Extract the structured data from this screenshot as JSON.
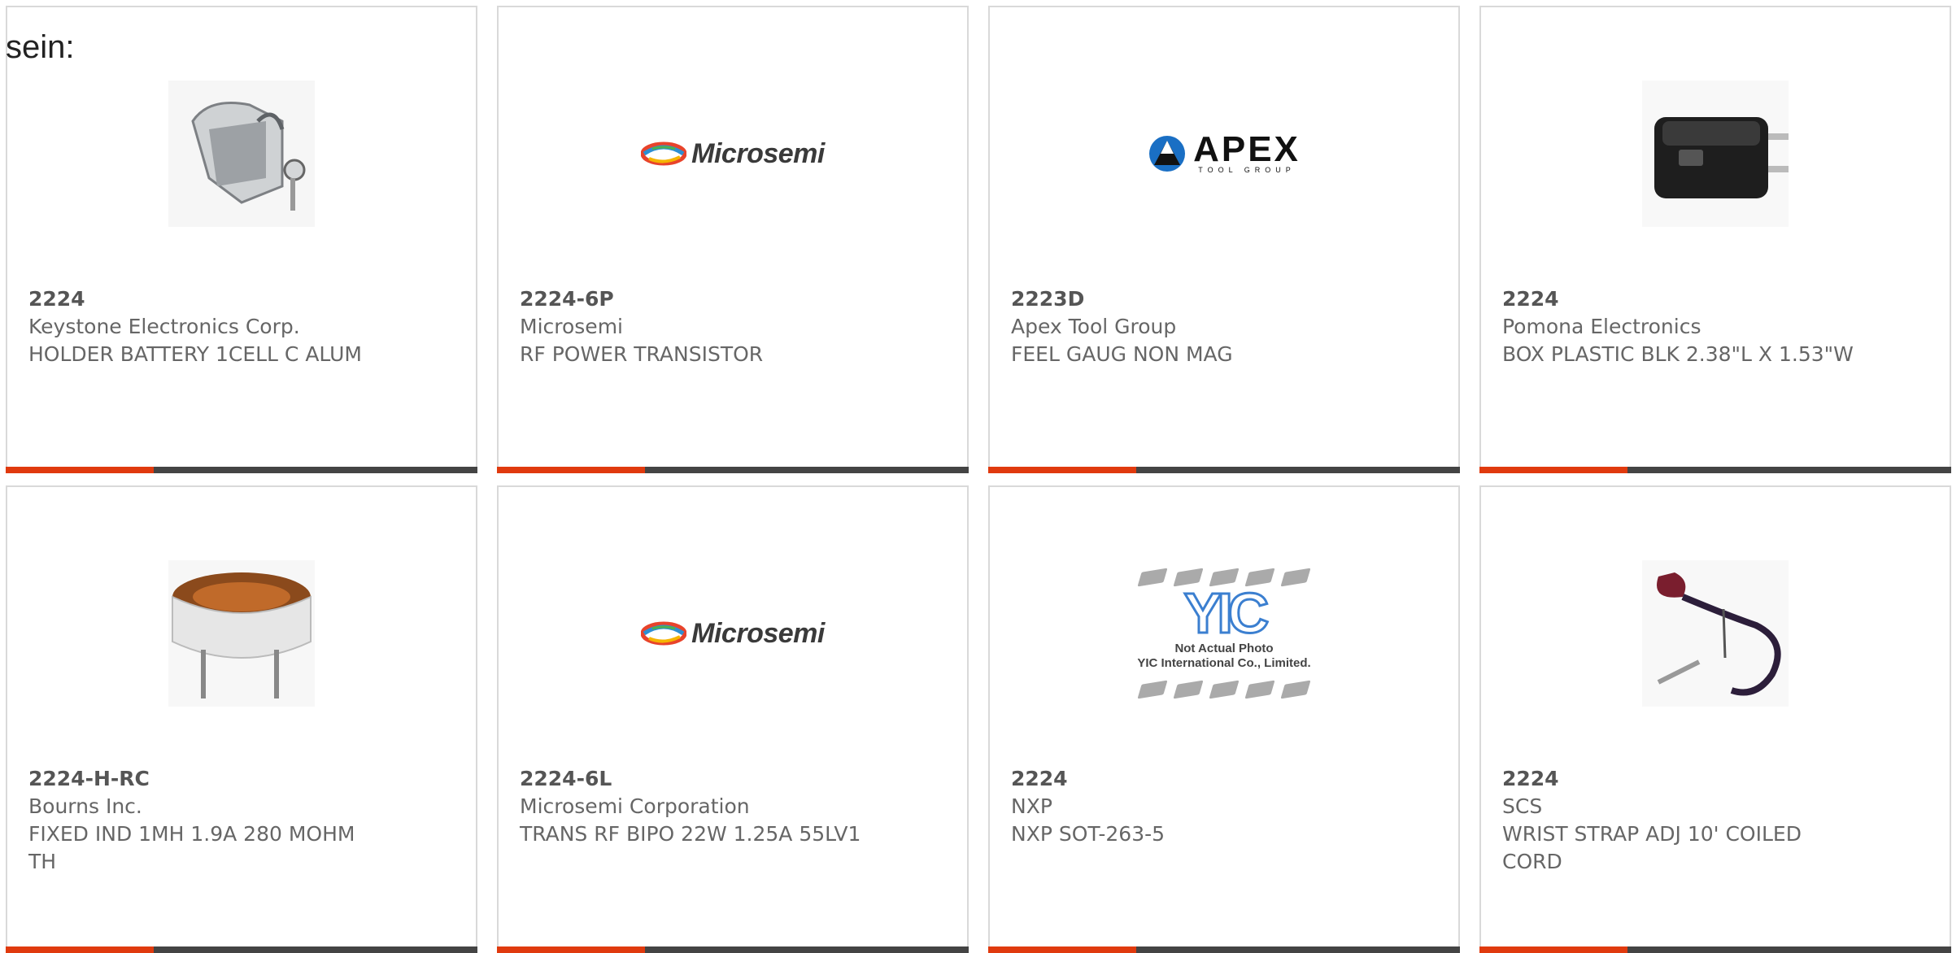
{
  "page": {
    "prefix_text": "sein:"
  },
  "products": [
    {
      "part_number": "2224",
      "manufacturer": "Keystone Electronics Corp.",
      "description": "HOLDER BATTERY 1CELL C ALUM",
      "image": "battery-holder-photo"
    },
    {
      "part_number": "2224-6P",
      "manufacturer": "Microsemi",
      "description": "RF POWER TRANSISTOR",
      "image": "microsemi-logo",
      "logo_text": "Microsemi"
    },
    {
      "part_number": "2223D",
      "manufacturer": "Apex Tool Group",
      "description": "FEEL GAUG NON MAG",
      "image": "apex-logo",
      "logo_text": "APEX",
      "logo_subtext": "TOOL GROUP"
    },
    {
      "part_number": "2224",
      "manufacturer": "Pomona Electronics",
      "description": "BOX PLASTIC BLK 2.38\"L X 1.53\"W",
      "image": "plastic-box-photo"
    },
    {
      "part_number": "2224-H-RC",
      "manufacturer": "Bourns Inc.",
      "description": "FIXED IND 1MH 1.9A 280 MOHM TH",
      "image": "toroid-inductor-photo"
    },
    {
      "part_number": "2224-6L",
      "manufacturer": "Microsemi Corporation",
      "description": "TRANS RF BIPO 22W 1.25A 55LV1",
      "image": "microsemi-logo",
      "logo_text": "Microsemi"
    },
    {
      "part_number": "2224",
      "manufacturer": "NXP",
      "description": "NXP SOT-263-5",
      "image": "yic-placeholder",
      "logo_text": "YIC",
      "note_line1": "Not Actual Photo",
      "note_line2": "YIC International Co., Limited."
    },
    {
      "part_number": "2224",
      "manufacturer": "SCS",
      "description": "WRIST STRAP ADJ 10' COILED CORD",
      "image": "wrist-strap-photo"
    }
  ],
  "colors": {
    "accent": "#e03a0e",
    "bar": "#444444",
    "border": "#d9d9d9",
    "text": "#666666"
  }
}
